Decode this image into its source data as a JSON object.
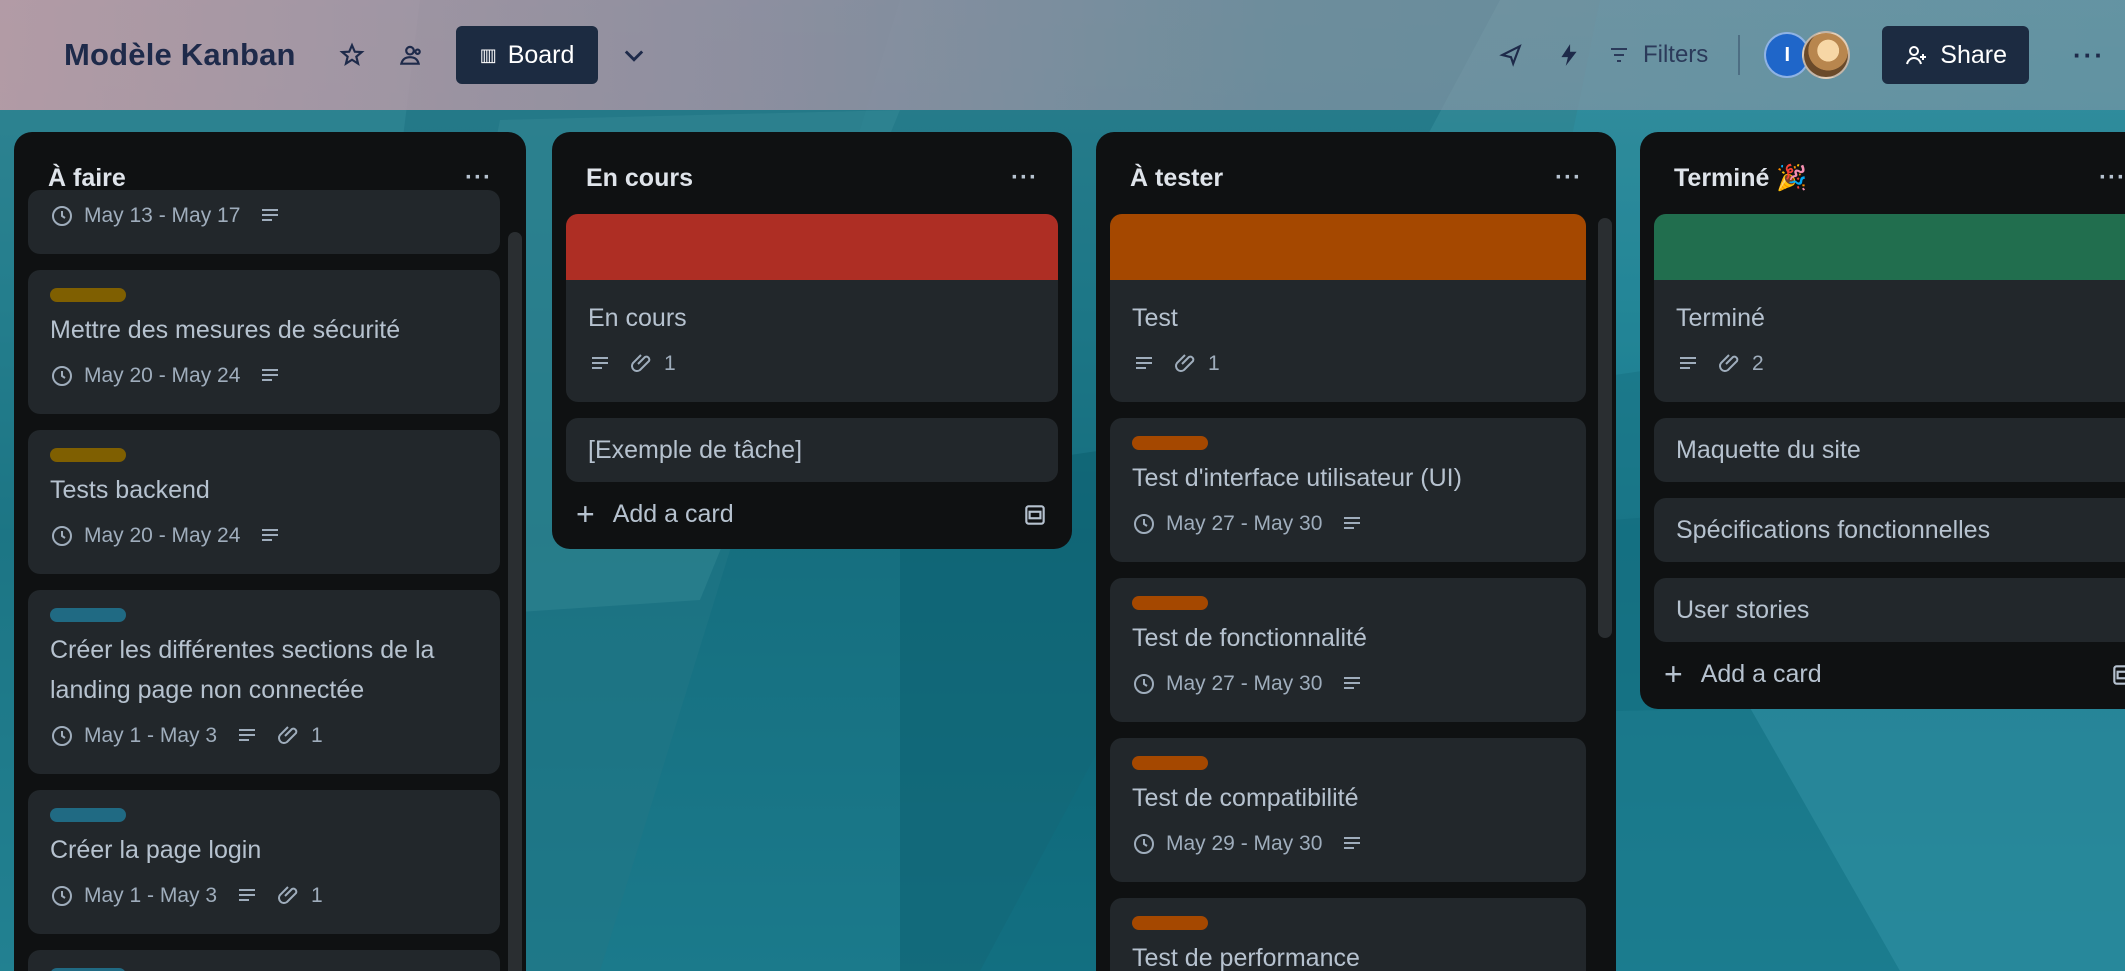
{
  "header": {
    "board_title": "Modèle Kanban",
    "view_label": "Board",
    "filters_label": "Filters",
    "avatar_initial": "I",
    "share_label": "Share",
    "more": "···"
  },
  "lists": [
    {
      "title": "À faire",
      "menu": "···",
      "cards": [
        {
          "title": "",
          "date": "May 13 - May 17",
          "has_desc": true
        },
        {
          "label_color": "#7f5f01",
          "title": "Mettre des mesures de sécurité",
          "date": "May 20 - May 24",
          "has_desc": true
        },
        {
          "label_color": "#7f5f01",
          "title": "Tests backend",
          "date": "May 20 - May 24",
          "has_desc": true
        },
        {
          "label_color": "#206a83",
          "title": "Créer les différentes sections de la landing page non connectée",
          "date": "May 1 - May 3",
          "has_desc": true,
          "attachments": "1"
        },
        {
          "label_color": "#206a83",
          "title": "Créer la page login",
          "date": "May 1 - May 3",
          "has_desc": true,
          "attachments": "1"
        }
      ]
    },
    {
      "title": "En cours",
      "menu": "···",
      "cards": [
        {
          "cover_color": "#ae2e24",
          "title": "En cours",
          "has_desc": true,
          "attachments": "1"
        },
        {
          "title": "[Exemple de tâche]"
        }
      ],
      "add_card": "Add a card"
    },
    {
      "title": "À tester",
      "menu": "···",
      "cards": [
        {
          "cover_color": "#a54800",
          "title": "Test",
          "has_desc": true,
          "attachments": "1"
        },
        {
          "label_color": "#a54800",
          "title": "Test d'interface utilisateur (UI)",
          "date": "May 27 - May 30",
          "has_desc": true
        },
        {
          "label_color": "#a54800",
          "title": "Test de fonctionnalité",
          "date": "May 27 - May 30",
          "has_desc": true
        },
        {
          "label_color": "#a54800",
          "title": "Test de compatibilité",
          "date": "May 29 - May 30",
          "has_desc": true
        },
        {
          "label_color": "#a54800",
          "title": "Test de performance"
        }
      ]
    },
    {
      "title": "Terminé 🎉",
      "menu": "···",
      "cards": [
        {
          "cover_color": "#216e4e",
          "title": "Terminé",
          "has_desc": true,
          "attachments": "2"
        },
        {
          "title": "Maquette du site"
        },
        {
          "title": "Spécifications fonctionnelles"
        },
        {
          "title": "User stories"
        }
      ],
      "add_card": "Add a card"
    }
  ]
}
